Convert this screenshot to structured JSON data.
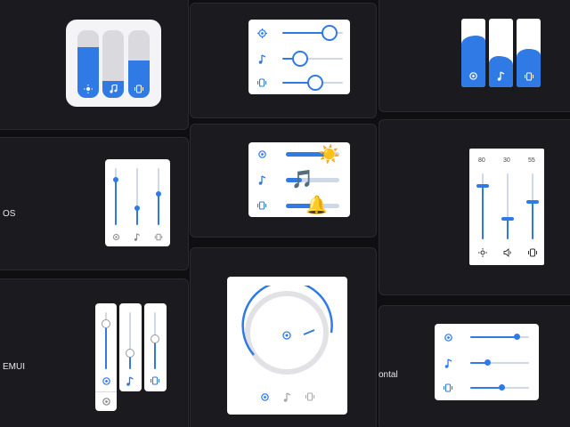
{
  "colors": {
    "accent": "#2f7ae5",
    "page_bg": "#0f0f12",
    "tile_bg": "#1b1b1f",
    "card_bg": "#ffffff"
  },
  "icons": [
    "settings-gear-icon",
    "music-note-icon",
    "vibrate-icon",
    "sun-icon",
    "volume-icon",
    "sun-emoji",
    "music-emoji",
    "bell-emoji"
  ],
  "labels": {
    "ios": "OS",
    "emui": "EMUI",
    "horizontal": "ontal"
  },
  "emoji": {
    "sun": "☀️",
    "music": "🎵",
    "bell": "🔔"
  },
  "numbered_sliders": {
    "values": [
      "80",
      "30",
      "55"
    ]
  },
  "levels": {
    "pill_sliders": [
      0.75,
      0.25,
      0.55
    ],
    "wave_sliders": [
      0.75,
      0.45,
      0.55
    ],
    "round_thumb_sliders": [
      0.78,
      0.28,
      0.55
    ],
    "emoji_sliders": [
      0.85,
      0.3,
      0.55
    ],
    "thin_vertical_sliders": [
      0.78,
      0.28,
      0.55
    ],
    "numbered_sliders": [
      0.8,
      0.3,
      0.55
    ],
    "tall_vertical_sliders": [
      0.8,
      0.3,
      0.55
    ],
    "knob_dial": 0.7,
    "horizontal_sliders": [
      0.8,
      0.3,
      0.55
    ]
  }
}
